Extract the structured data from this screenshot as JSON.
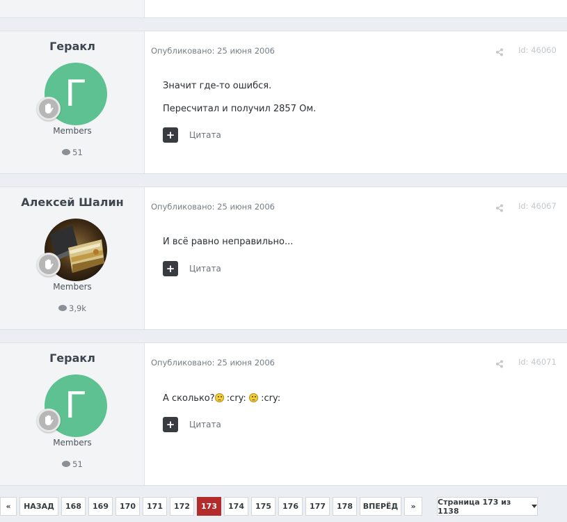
{
  "posts": [
    {
      "author": "Геракл",
      "avatar_letter": "Г",
      "group": "Members",
      "post_count": "51",
      "date": "Опубликовано: 25 июня 2006",
      "post_id": "Id: 46060",
      "lines": [
        "Значит где-то ошибся.",
        "Пересчитал и получил 2857 Ом."
      ],
      "quote_label": "Цитата"
    },
    {
      "author": "Алексей Шалин",
      "group": "Members",
      "post_count": "3,9k",
      "date": "Опубликовано: 25 июня 2006",
      "post_id": "Id: 46067",
      "lines": [
        "И всё равно неправильно..."
      ],
      "quote_label": "Цитата"
    },
    {
      "author": "Геракл",
      "avatar_letter": "Г",
      "group": "Members",
      "post_count": "51",
      "date": "Опубликовано: 25 июня 2006",
      "post_id": "Id: 46071",
      "text_a": "А сколько?",
      "text_b": ":cry:",
      "text_c": ":cry:",
      "quote_label": "Цитата"
    }
  ],
  "pagination": {
    "first": "«",
    "prev": "НАЗАД",
    "pages": [
      "168",
      "169",
      "170",
      "171",
      "172",
      "173",
      "174",
      "175",
      "176",
      "177",
      "178"
    ],
    "current": "173",
    "next": "ВПЕРЁД",
    "last": "»",
    "page_of": "Страница 173 из 1138"
  },
  "colors": {
    "avatar_green": "#5ec191",
    "active_page": "#b22c2c",
    "quote_button": "#383c40"
  },
  "icons": [
    "share-icon",
    "comment-icon",
    "plus-icon",
    "rank-badge-icon",
    "sad-emoji-icon",
    "caret-down-icon"
  ]
}
